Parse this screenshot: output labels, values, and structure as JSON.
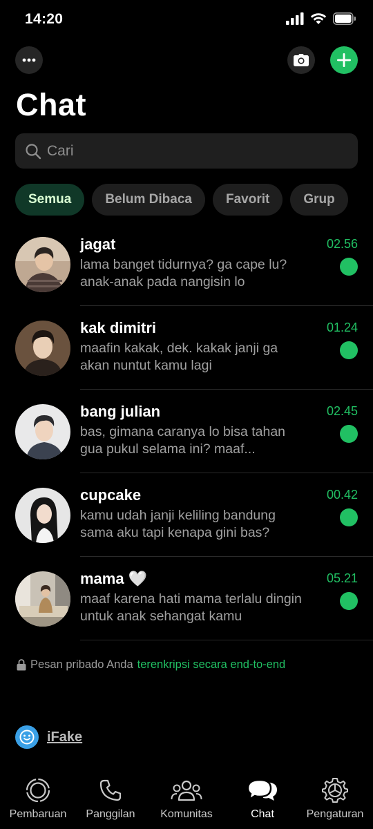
{
  "status_bar": {
    "time": "14:20"
  },
  "header": {
    "title": "Chat"
  },
  "search": {
    "placeholder": "Cari"
  },
  "filters": [
    "Semua",
    "Belum Dibaca",
    "Favorit",
    "Grup"
  ],
  "active_filter": "Semua",
  "chats": [
    {
      "name": "jagat",
      "time": "02.56",
      "preview": "lama banget tidurnya? ga cape lu? anak-anak pada nangisin lo",
      "unread": true
    },
    {
      "name": "kak dimitri",
      "time": "01.24",
      "preview": "maafin kakak, dek. kakak janji ga akan nuntut kamu lagi",
      "unread": true
    },
    {
      "name": "bang julian",
      "time": "02.45",
      "preview": "bas, gimana caranya lo bisa tahan gua pukul selama ini? maaf...",
      "unread": true
    },
    {
      "name": "cupcake",
      "time": "00.42",
      "preview": "kamu udah janji keliling bandung sama aku tapi kenapa gini bas?",
      "unread": true
    },
    {
      "name": "mama 🤍",
      "time": "05.21",
      "preview": "maaf karena hati mama terlalu dingin untuk anak sehangat kamu",
      "unread": true
    }
  ],
  "encryption": {
    "prefix": "Pesan pribado Anda",
    "link": "terenkripsi secara end-to-end"
  },
  "watermark": {
    "text": "iFake"
  },
  "tabs": [
    {
      "label": "Pembaruan",
      "icon": "status-updates-icon"
    },
    {
      "label": "Panggilan",
      "icon": "phone-icon"
    },
    {
      "label": "Komunitas",
      "icon": "community-icon"
    },
    {
      "label": "Chat",
      "icon": "chat-bubbles-icon",
      "active": true
    },
    {
      "label": "Pengaturan",
      "icon": "gear-icon"
    }
  ],
  "colors": {
    "accent": "#21c063",
    "background": "#000000",
    "active_chip_bg": "#103828"
  }
}
